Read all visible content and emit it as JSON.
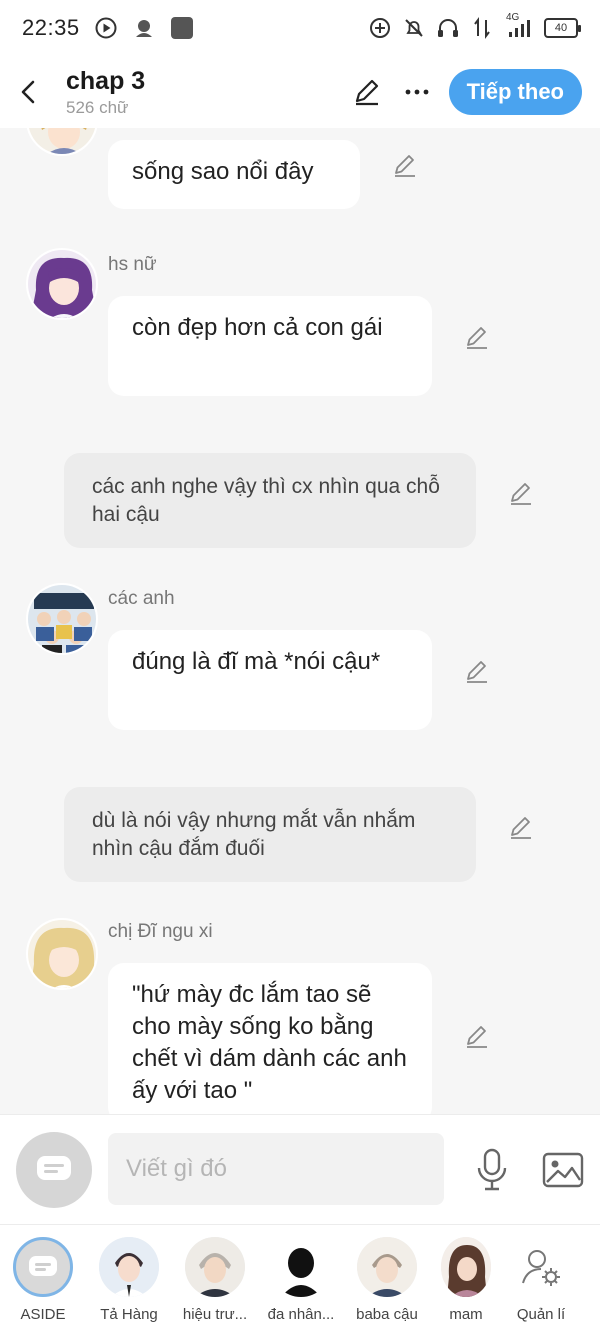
{
  "status_bar": {
    "time": "22:35",
    "network": "4G",
    "battery": "40"
  },
  "header": {
    "title": "chap 3",
    "word_count": "526 chữ",
    "next_label": "Tiếp theo"
  },
  "messages": [
    {
      "type": "character",
      "sender": "",
      "text": "sống sao nổi đây"
    },
    {
      "type": "character",
      "sender": "hs nữ",
      "text": "còn đẹp hơn cả con gái"
    },
    {
      "type": "narration",
      "text": "các anh nghe vậy thì cx nhìn qua chỗ hai cậu"
    },
    {
      "type": "character",
      "sender": "các anh",
      "text": "đúng là đĩ mà *nói cậu*"
    },
    {
      "type": "narration",
      "text": "dù là nói vậy nhưng mắt vẫn nhắm nhìn cậu đắm đuối"
    },
    {
      "type": "character",
      "sender": "chị Đĩ ngu xi",
      "text": "\"hứ mày đc lắm tao sẽ cho mày sống ko bằng chết vì dám dành các anh ấy với tao \""
    }
  ],
  "input": {
    "placeholder": "Viết gì đó"
  },
  "characters": [
    {
      "name": "ASIDE"
    },
    {
      "name": "Tả Hàng"
    },
    {
      "name": "hiệu trư..."
    },
    {
      "name": "đa nhân..."
    },
    {
      "name": "baba cậu"
    },
    {
      "name": "mam"
    },
    {
      "name": "Quản lí"
    }
  ],
  "colors": {
    "accent": "#4aa3ef",
    "narration_bg": "#ececec",
    "background": "#f6f6f6"
  }
}
